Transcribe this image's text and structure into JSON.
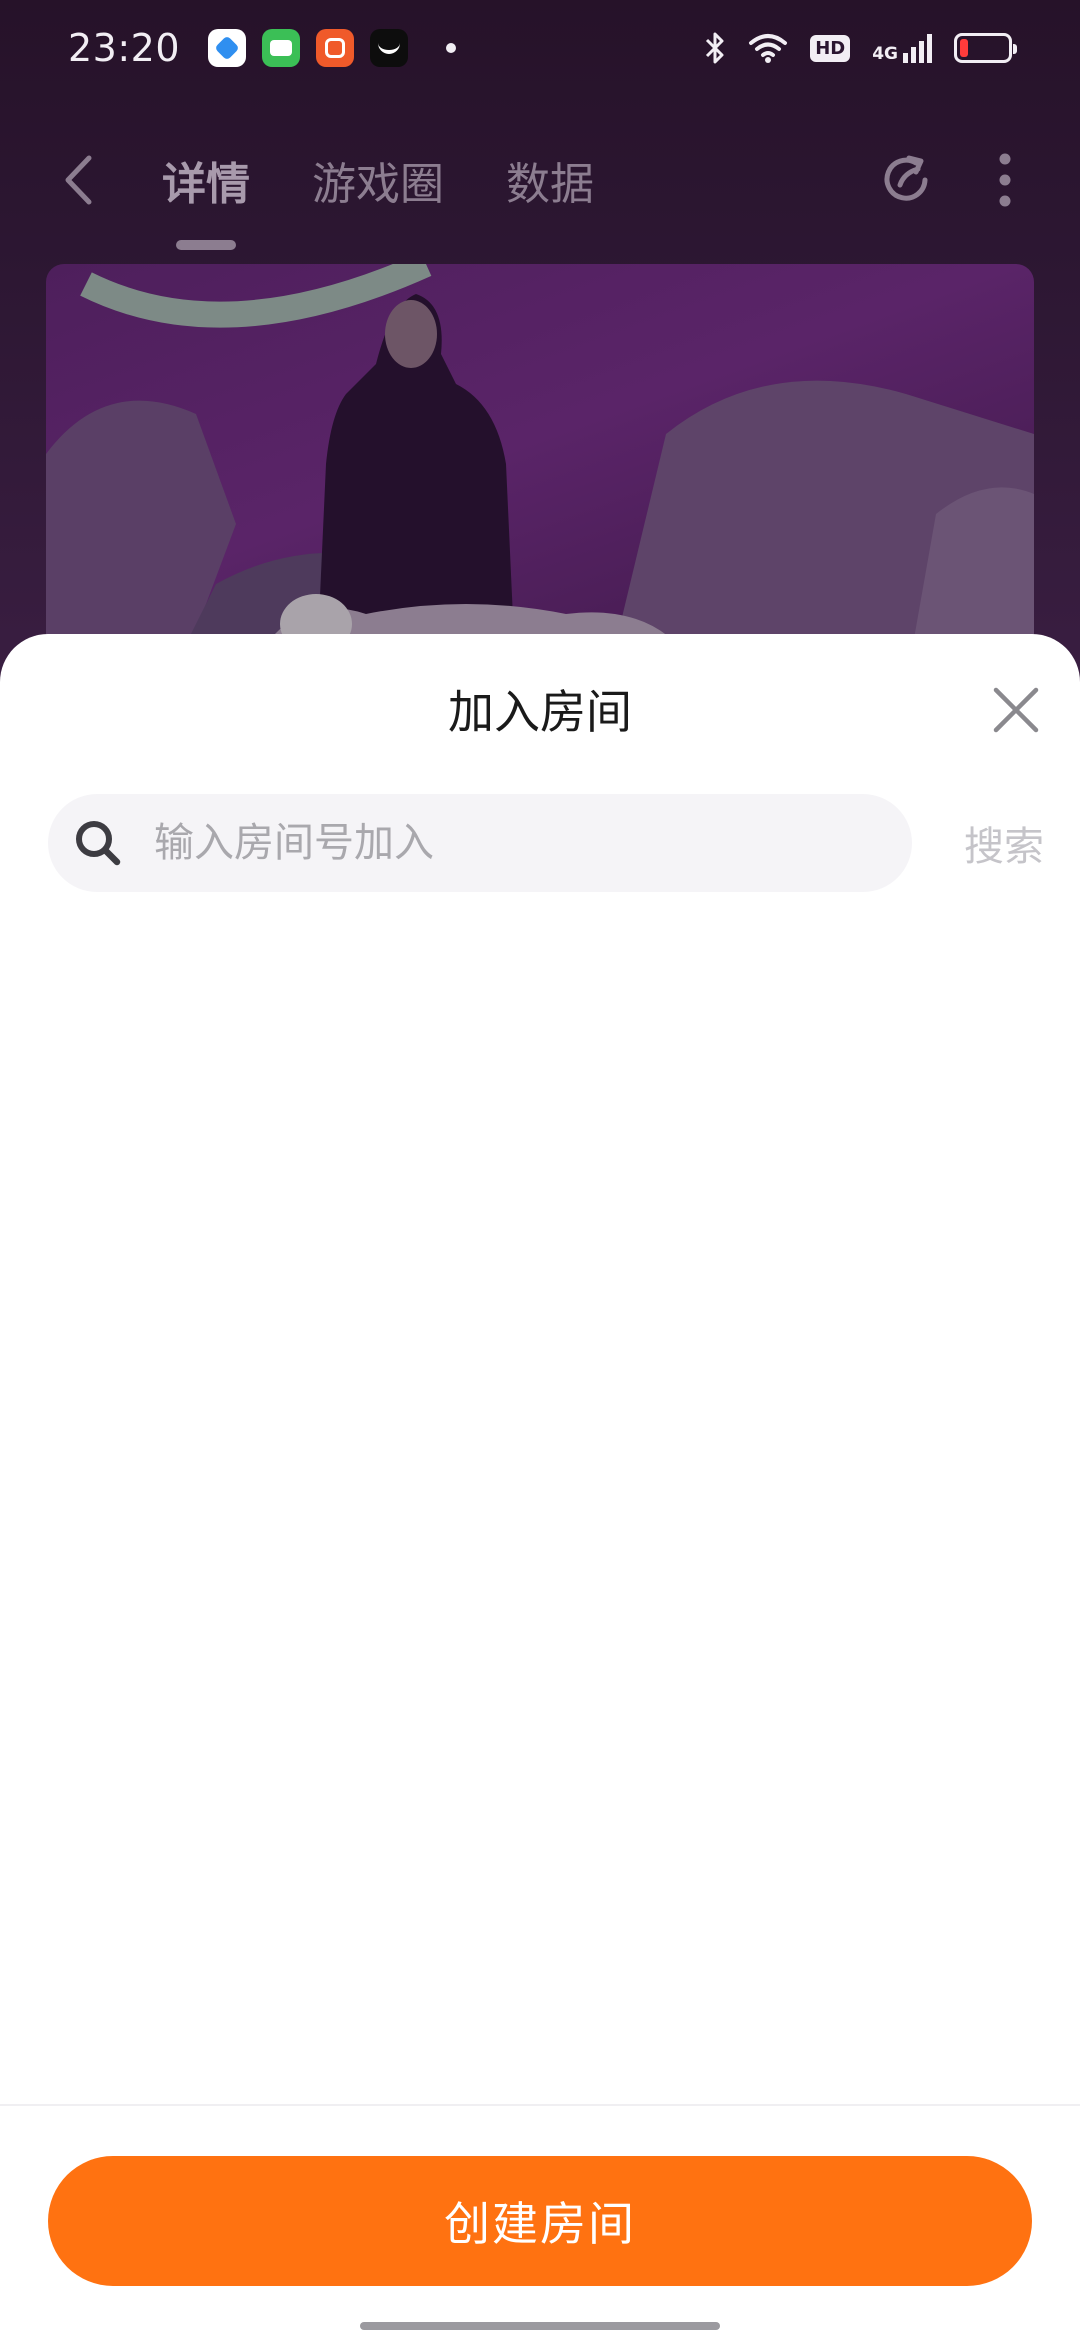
{
  "status_bar": {
    "time": "23:20",
    "hd_label": "HD",
    "network_label": "4G",
    "battery_color": "#ff3b3b"
  },
  "nav": {
    "tabs": [
      {
        "label": "详情",
        "active": true
      },
      {
        "label": "游戏圈",
        "active": false
      },
      {
        "label": "数据",
        "active": false
      }
    ],
    "icons": [
      "back-arrow-icon",
      "share-refresh-icon",
      "more-vertical-icon"
    ]
  },
  "sheet": {
    "title": "加入房间",
    "search": {
      "placeholder": "输入房间号加入",
      "value": "",
      "button_label": "搜索"
    },
    "create_button_label": "创建房间"
  },
  "colors": {
    "accent": "#ff7211",
    "background_app": "#2d1733"
  }
}
